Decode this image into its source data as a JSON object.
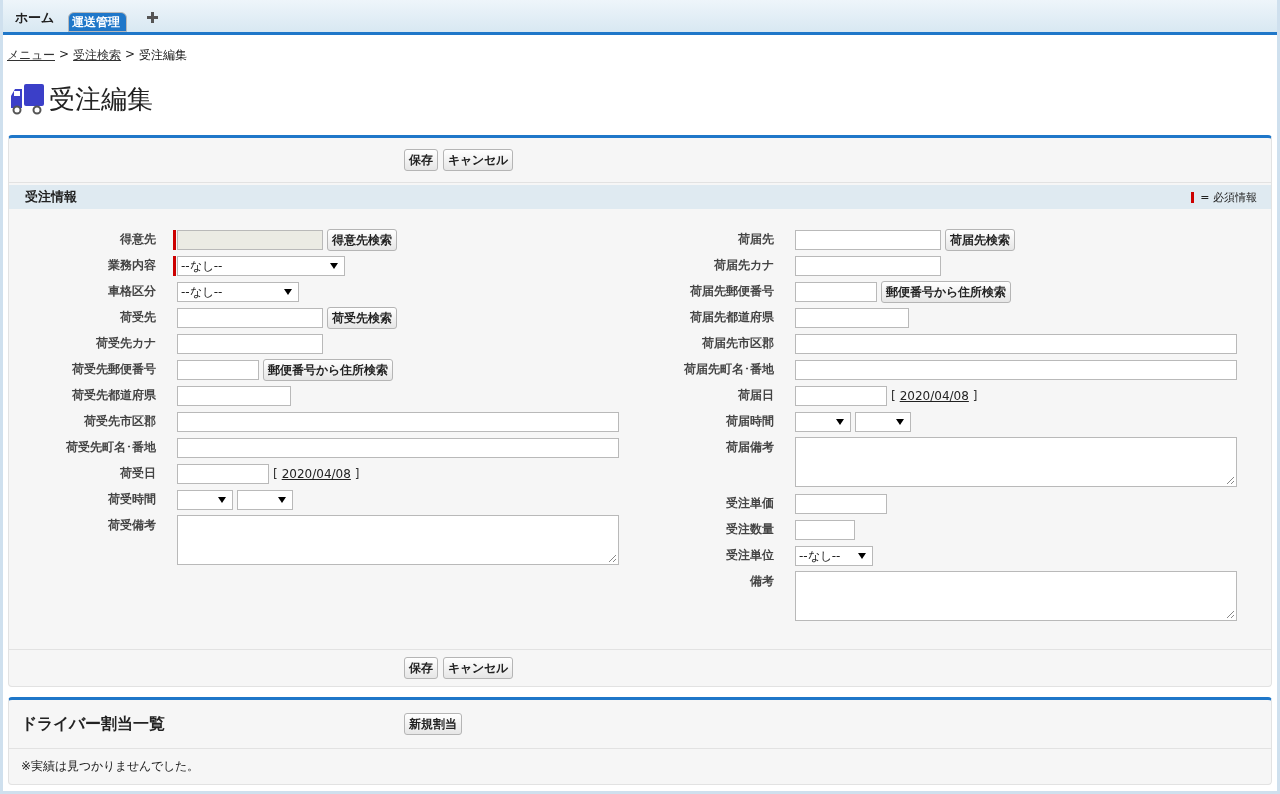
{
  "tabs": [
    {
      "label": "ホーム",
      "selected": false
    },
    {
      "label": "運送管理",
      "selected": true
    }
  ],
  "breadcrumb": [
    {
      "label": "メニュー",
      "link": true
    },
    {
      "label": "受注検索",
      "link": true,
      "separator": ">"
    },
    {
      "label": "受注編集",
      "link": false,
      "separator": ">"
    }
  ],
  "page_title": "受注編集",
  "form": {
    "top_buttons": [
      "保存",
      "キャンセル"
    ],
    "section_title": "受注情報",
    "required_legend": "= 必須情報",
    "left_fields": [
      {
        "label": "得意先",
        "kind": "lookup",
        "required": true,
        "disabled": true,
        "button": "得意先検索"
      },
      {
        "label": "業務内容",
        "kind": "select_wide",
        "required": true,
        "disabled": false,
        "value": "--なし--"
      },
      {
        "label": "車格区分",
        "kind": "select",
        "required": false,
        "disabled": false,
        "value": "--なし--"
      },
      {
        "label": "荷受先",
        "kind": "lookup",
        "required": false,
        "disabled": false,
        "button": "荷受先検索"
      },
      {
        "label": "荷受先カナ",
        "kind": "text",
        "required": false,
        "disabled": false
      },
      {
        "label": "荷受先郵便番号",
        "kind": "zip",
        "required": false,
        "disabled": false,
        "button": "郵便番号から住所検索"
      },
      {
        "label": "荷受先都道府県",
        "kind": "pref",
        "required": false,
        "disabled": false
      },
      {
        "label": "荷受先市区郡",
        "kind": "address",
        "required": false,
        "disabled": false
      },
      {
        "label": "荷受先町名･番地",
        "kind": "address",
        "required": false,
        "disabled": false
      },
      {
        "label": "荷受日",
        "kind": "date",
        "required": false,
        "disabled": false,
        "open": "[",
        "today": "2020/04/08",
        "close": "]"
      },
      {
        "label": "荷受時間",
        "kind": "time",
        "required": false,
        "disabled": false
      },
      {
        "label": "荷受備考",
        "kind": "memo",
        "required": false,
        "disabled": false
      }
    ],
    "right_fields": [
      {
        "label": "荷届先",
        "kind": "lookup",
        "required": false,
        "disabled": false,
        "button": "荷届先検索"
      },
      {
        "label": "荷届先カナ",
        "kind": "text",
        "required": false,
        "disabled": false
      },
      {
        "label": "荷届先郵便番号",
        "kind": "zip",
        "required": false,
        "disabled": false,
        "button": "郵便番号から住所検索"
      },
      {
        "label": "荷届先都道府県",
        "kind": "pref",
        "required": false,
        "disabled": false
      },
      {
        "label": "荷届先市区郡",
        "kind": "address",
        "required": false,
        "disabled": false
      },
      {
        "label": "荷届先町名･番地",
        "kind": "address",
        "required": false,
        "disabled": false
      },
      {
        "label": "荷届日",
        "kind": "date",
        "required": false,
        "disabled": false,
        "open": "[",
        "today": "2020/04/08",
        "close": "]"
      },
      {
        "label": "荷届時間",
        "kind": "time",
        "required": false,
        "disabled": false
      },
      {
        "label": "荷届備考",
        "kind": "memo",
        "required": false,
        "disabled": false
      },
      {
        "label": "受注単価",
        "kind": "price",
        "required": false,
        "disabled": false
      },
      {
        "label": "受注数量",
        "kind": "qty",
        "required": false,
        "disabled": false
      },
      {
        "label": "受注単位",
        "kind": "select_small",
        "required": false,
        "disabled": false,
        "value": "--なし--"
      },
      {
        "label": "備考",
        "kind": "memo",
        "required": false,
        "disabled": false
      }
    ],
    "bottom_buttons": [
      "保存",
      "キャンセル"
    ]
  },
  "drivers": {
    "title": "ドライバー割当一覧",
    "button": "新規割当",
    "message": "※実績は見つかりませんでした。"
  }
}
